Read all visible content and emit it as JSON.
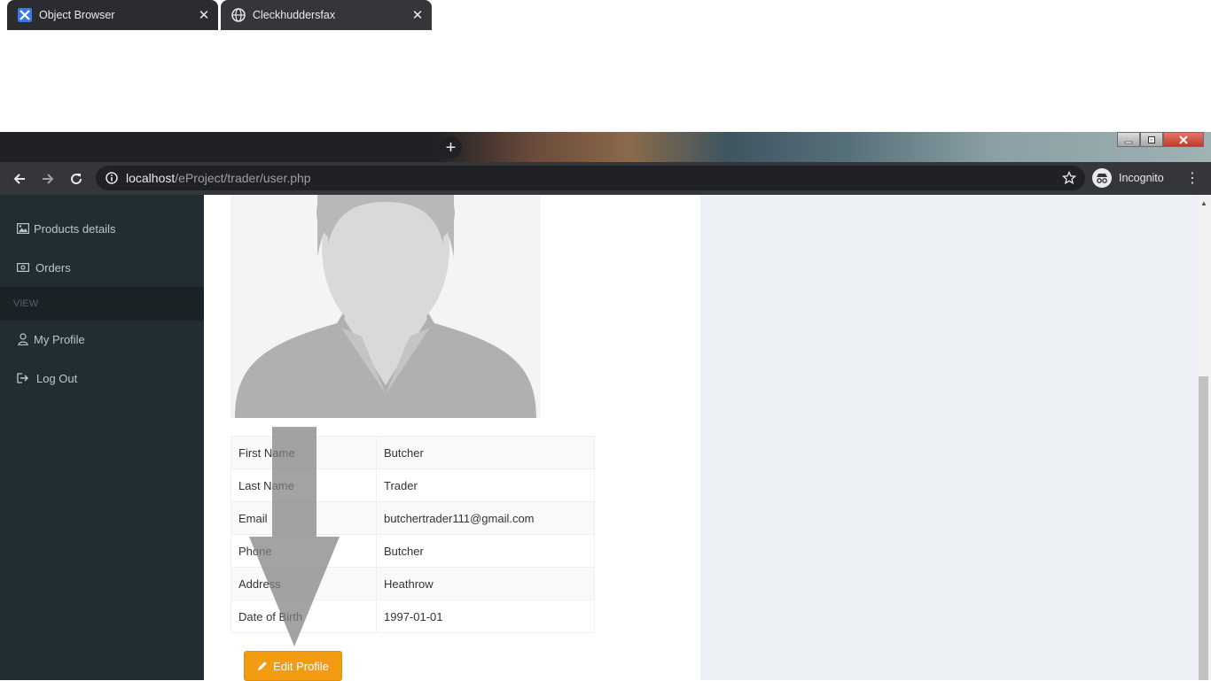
{
  "browser": {
    "tabs": [
      {
        "title": "Object Browser",
        "close": "✕"
      },
      {
        "title": "Cleckhuddersfax",
        "close": "✕"
      }
    ],
    "new_tab": "+",
    "url_host": "localhost",
    "url_path": "/eProject/trader/user.php",
    "profile_label": "Incognito",
    "menu": "⋮"
  },
  "sidebar": {
    "items_top": [
      {
        "label": "Products details",
        "icon": "image-icon"
      },
      {
        "label": "Orders",
        "icon": "money-icon"
      }
    ],
    "section_header": "VIEW",
    "items_view": [
      {
        "label": "My Profile",
        "icon": "user-icon"
      },
      {
        "label": "Log Out",
        "icon": "sign-out-icon"
      }
    ]
  },
  "profile": {
    "rows": [
      {
        "label": "First Name",
        "value": "Butcher"
      },
      {
        "label": "Last Name",
        "value": "Trader"
      },
      {
        "label": "Email",
        "value": "butchertrader111@gmail.com"
      },
      {
        "label": "Phone",
        "value": "Butcher"
      },
      {
        "label": "Address",
        "value": "Heathrow"
      },
      {
        "label": "Date of Birth",
        "value": "1997-01-01"
      }
    ],
    "edit_button": "Edit Profile"
  },
  "colors": {
    "sidebar_bg": "#222d32",
    "edit_button": "#f39c12",
    "content_bg": "#ecf0f5"
  }
}
